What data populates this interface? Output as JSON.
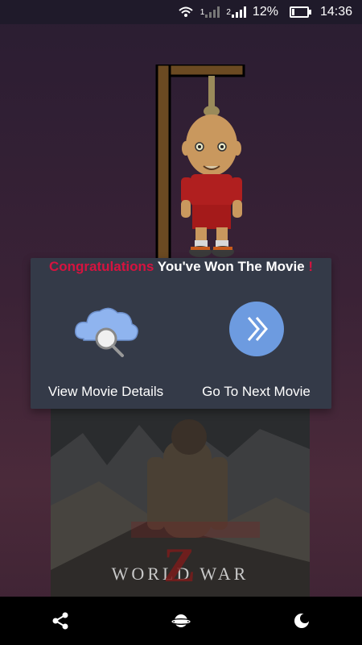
{
  "status_bar": {
    "sim_indicator_1": "1",
    "sim_indicator_2": "2",
    "battery_percent": "12%",
    "time": "14:36"
  },
  "dialog": {
    "title_accent": "Congratulations",
    "title_main": " You've Won The Movie ",
    "title_bang": "!",
    "view_details_label": "View Movie Details",
    "next_movie_label": "Go To Next Movie"
  },
  "poster": {
    "title": "WORLD WAR",
    "letter": "Z"
  },
  "colors": {
    "accent_red": "#d6133f",
    "dialog_bg": "#343a48",
    "next_button_blue": "#6d9be0",
    "cloud_blue": "#8fb4ef"
  },
  "icons": {
    "view_details": "cloud-search-icon",
    "next_movie": "double-chevron-right-icon",
    "nav_left": "share-icon",
    "nav_center": "planet-icon",
    "nav_right": "moon-icon"
  }
}
